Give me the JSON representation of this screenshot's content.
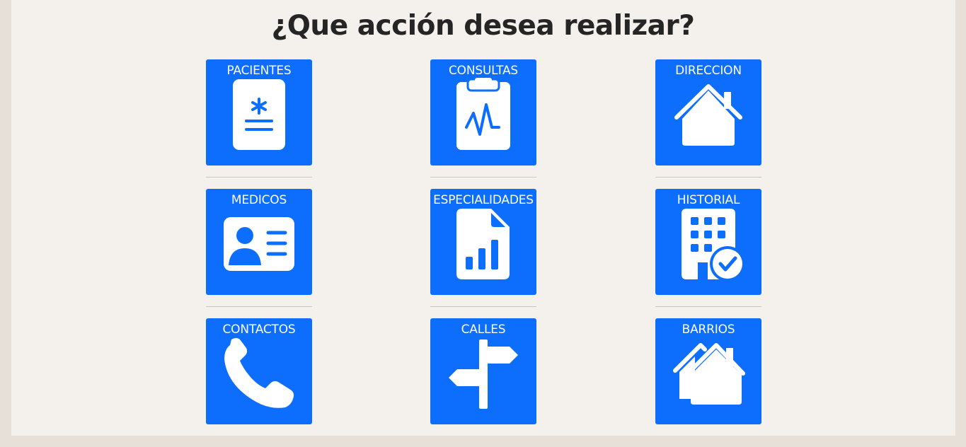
{
  "page": {
    "title": "¿Que acción desea realizar?"
  },
  "tiles": [
    {
      "label": "PACIENTES",
      "icon": "patient-id-card-icon"
    },
    {
      "label": "CONSULTAS",
      "icon": "clipboard-pulse-icon"
    },
    {
      "label": "DIRECCION",
      "icon": "house-icon"
    },
    {
      "label": "MEDICOS",
      "icon": "person-id-card-icon"
    },
    {
      "label": "ESPECIALIDADES",
      "icon": "file-chart-icon"
    },
    {
      "label": "HISTORIAL",
      "icon": "building-check-icon"
    },
    {
      "label": "CONTACTOS",
      "icon": "phone-icon"
    },
    {
      "label": "CALLES",
      "icon": "signpost-icon"
    },
    {
      "label": "BARRIOS",
      "icon": "houses-icon"
    }
  ],
  "colors": {
    "tile": "#0d6efd",
    "background": "#f4f1ed",
    "frame": "#e6e0d8",
    "title": "#252525"
  }
}
